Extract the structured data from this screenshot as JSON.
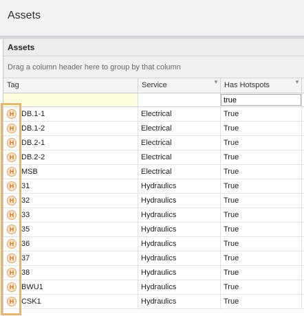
{
  "page": {
    "title": "Assets"
  },
  "panel": {
    "caption": "Assets",
    "group_hint": "Drag a column header here to group by that column"
  },
  "grid": {
    "columns": [
      {
        "label": "Tag",
        "filterable": false
      },
      {
        "label": "Service",
        "filterable": true
      },
      {
        "label": "Has Hotspots",
        "filterable": true
      }
    ],
    "filter": {
      "tag": "",
      "service": "",
      "has_hotspots": "true"
    },
    "hotspot_icon_glyph": "H",
    "rows": [
      {
        "tag": "DB.1-1",
        "service": "Electrical",
        "has_hotspots": "True"
      },
      {
        "tag": "DB.1-2",
        "service": "Electrical",
        "has_hotspots": "True"
      },
      {
        "tag": "DB.2-1",
        "service": "Electrical",
        "has_hotspots": "True"
      },
      {
        "tag": "DB.2-2",
        "service": "Electrical",
        "has_hotspots": "True"
      },
      {
        "tag": "MSB",
        "service": "Electrical",
        "has_hotspots": "True"
      },
      {
        "tag": "31",
        "service": "Hydraulics",
        "has_hotspots": "True"
      },
      {
        "tag": "32",
        "service": "Hydraulics",
        "has_hotspots": "True"
      },
      {
        "tag": "33",
        "service": "Hydraulics",
        "has_hotspots": "True"
      },
      {
        "tag": "35",
        "service": "Hydraulics",
        "has_hotspots": "True"
      },
      {
        "tag": "36",
        "service": "Hydraulics",
        "has_hotspots": "True"
      },
      {
        "tag": "37",
        "service": "Hydraulics",
        "has_hotspots": "True"
      },
      {
        "tag": "38",
        "service": "Hydraulics",
        "has_hotspots": "True"
      },
      {
        "tag": "BWU1",
        "service": "Hydraulics",
        "has_hotspots": "True"
      },
      {
        "tag": "CSK1",
        "service": "Hydraulics",
        "has_hotspots": "True"
      }
    ]
  },
  "colors": {
    "highlight": "#e6b46b",
    "hotspot_icon": "#d7731c",
    "filter_row_tag": "#fffde0"
  }
}
